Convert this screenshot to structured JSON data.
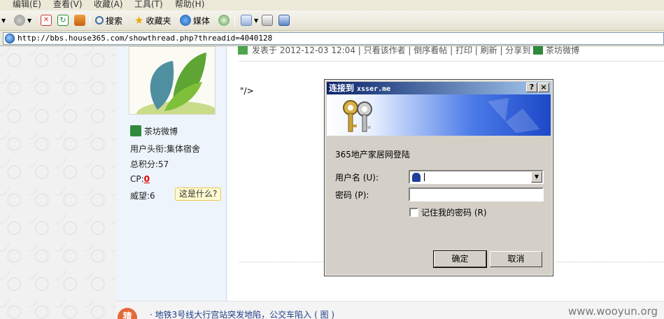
{
  "menu": [
    "编辑(E)",
    "查看(V)",
    "收藏(A)",
    "工具(T)",
    "帮助(H)"
  ],
  "toolbar": {
    "search": "搜索",
    "favorites": "收藏夹",
    "media": "媒体"
  },
  "address": {
    "url": "http://bbs.house365.com/showthread.php?threadid=4040128"
  },
  "profile": {
    "weibo": "茶坊微博",
    "title": "用户头衔:集体宿舍",
    "points": "总积分:57",
    "cp_label": "CP:",
    "cp_value": "0",
    "prestige": "威望:6",
    "whats_this": "这是什么?"
  },
  "post": {
    "meta": "发表于 2012-12-03 12:04 | 只看该作者 | 倒序看帖 | 打印 | 刷新 | 分享到",
    "share_weibo": "茶坊微博",
    "body": "\"/>"
  },
  "footer": {
    "guess": "猜",
    "news": "· 地铁3号线大行宫站突发地陷，公交车陷入 ( 图 )",
    "watermark": "www.wooyun.org"
  },
  "dialog": {
    "title": "连接到",
    "host": "xsser.me",
    "realm": "365地产家居网登陆",
    "username_label": "用户名 (U):",
    "password_label": "密码 (P):",
    "username_value": "",
    "password_value": "",
    "remember_label": "记住我的密码 (R)",
    "ok": "确定",
    "cancel": "取消",
    "help_btn": "?",
    "close_btn": "×"
  }
}
